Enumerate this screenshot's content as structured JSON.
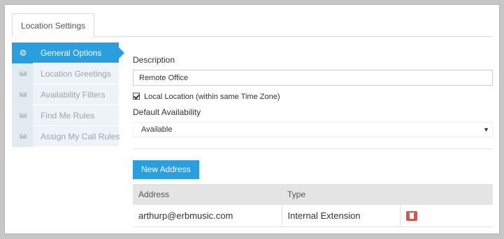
{
  "tabs": [
    {
      "label": "Location Settings"
    }
  ],
  "sidebar": {
    "items": [
      {
        "label": "General Options",
        "icon": "gear-icon",
        "active": true
      },
      {
        "label": "Location Greetings",
        "icon": "envelope-icon",
        "active": false
      },
      {
        "label": "Availability Filters",
        "icon": "envelope-icon",
        "active": false
      },
      {
        "label": "Find Me Rules",
        "icon": "envelope-icon",
        "active": false
      },
      {
        "label": "Assign My Call Rules",
        "icon": "envelope-icon",
        "active": false
      }
    ]
  },
  "form": {
    "description_label": "Description",
    "description_value": "Remote Office",
    "local_location_label": "Local Location (within same Time Zone)",
    "local_location_checked": true,
    "default_availability_label": "Default Availability",
    "default_availability_value": "Available"
  },
  "address": {
    "new_button_label": "New Address",
    "columns": [
      "Address",
      "Type"
    ],
    "rows": [
      {
        "address": "arthurp@erbmusic.com",
        "type": "Internal Extension"
      }
    ]
  },
  "colors": {
    "accent": "#2a9fe0",
    "danger": "#d9534f"
  }
}
